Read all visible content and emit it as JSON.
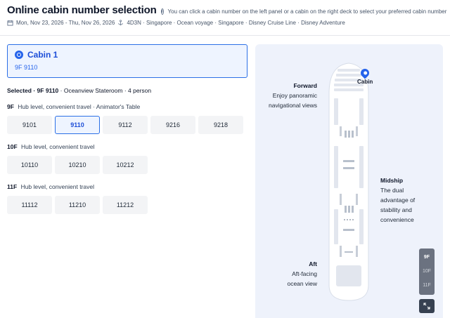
{
  "header": {
    "title": "Online cabin number selection",
    "info_icon": "info-icon",
    "hint": "You can click a cabin number on the left panel or a cabin on the right deck to select your preferred cabin number",
    "dates": "Mon, Nov 23, 2026 - Thu, Nov 26, 2026",
    "trip": "4D3N · Singapore · Ocean voyage · Singapore · Disney Cruise Line · Disney Adventure"
  },
  "cabin_card": {
    "title": "Cabin 1",
    "selected": "9F 9110"
  },
  "selected_line": {
    "prefix": "Selected",
    "cabin": "9F 9110",
    "details": "· Oceanview Stateroom · 4 person"
  },
  "floors": [
    {
      "floor": "9F",
      "desc": "Hub level, convenient travel · Animator's Table",
      "cabins": [
        "9101",
        "9110",
        "9112",
        "9216",
        "9218"
      ],
      "active": "9110"
    },
    {
      "floor": "10F",
      "desc": "Hub level, convenient travel",
      "cabins": [
        "10110",
        "10210",
        "10212"
      ]
    },
    {
      "floor": "11F",
      "desc": "Hub level, convenient travel",
      "cabins": [
        "11112",
        "11210",
        "11212"
      ]
    }
  ],
  "deck_map": {
    "forward": {
      "name": "Forward",
      "line1": "Enjoy panoramic",
      "line2": "navigational views"
    },
    "midship": {
      "name": "Midship",
      "line1": "The dual",
      "line2": "advantage of",
      "line3": "stability and",
      "line4": "convenience"
    },
    "aft": {
      "name": "Aft",
      "line1": "Aft-facing",
      "line2": "ocean view"
    },
    "pin_label": "Cabin",
    "decks": [
      "9F",
      "10F",
      "11F"
    ],
    "active_deck": "9F",
    "expand_icon": "expand-icon"
  },
  "colors": {
    "accent": "#2563eb",
    "panel_bg": "#eef2fb",
    "button_bg": "#f3f4f6"
  }
}
